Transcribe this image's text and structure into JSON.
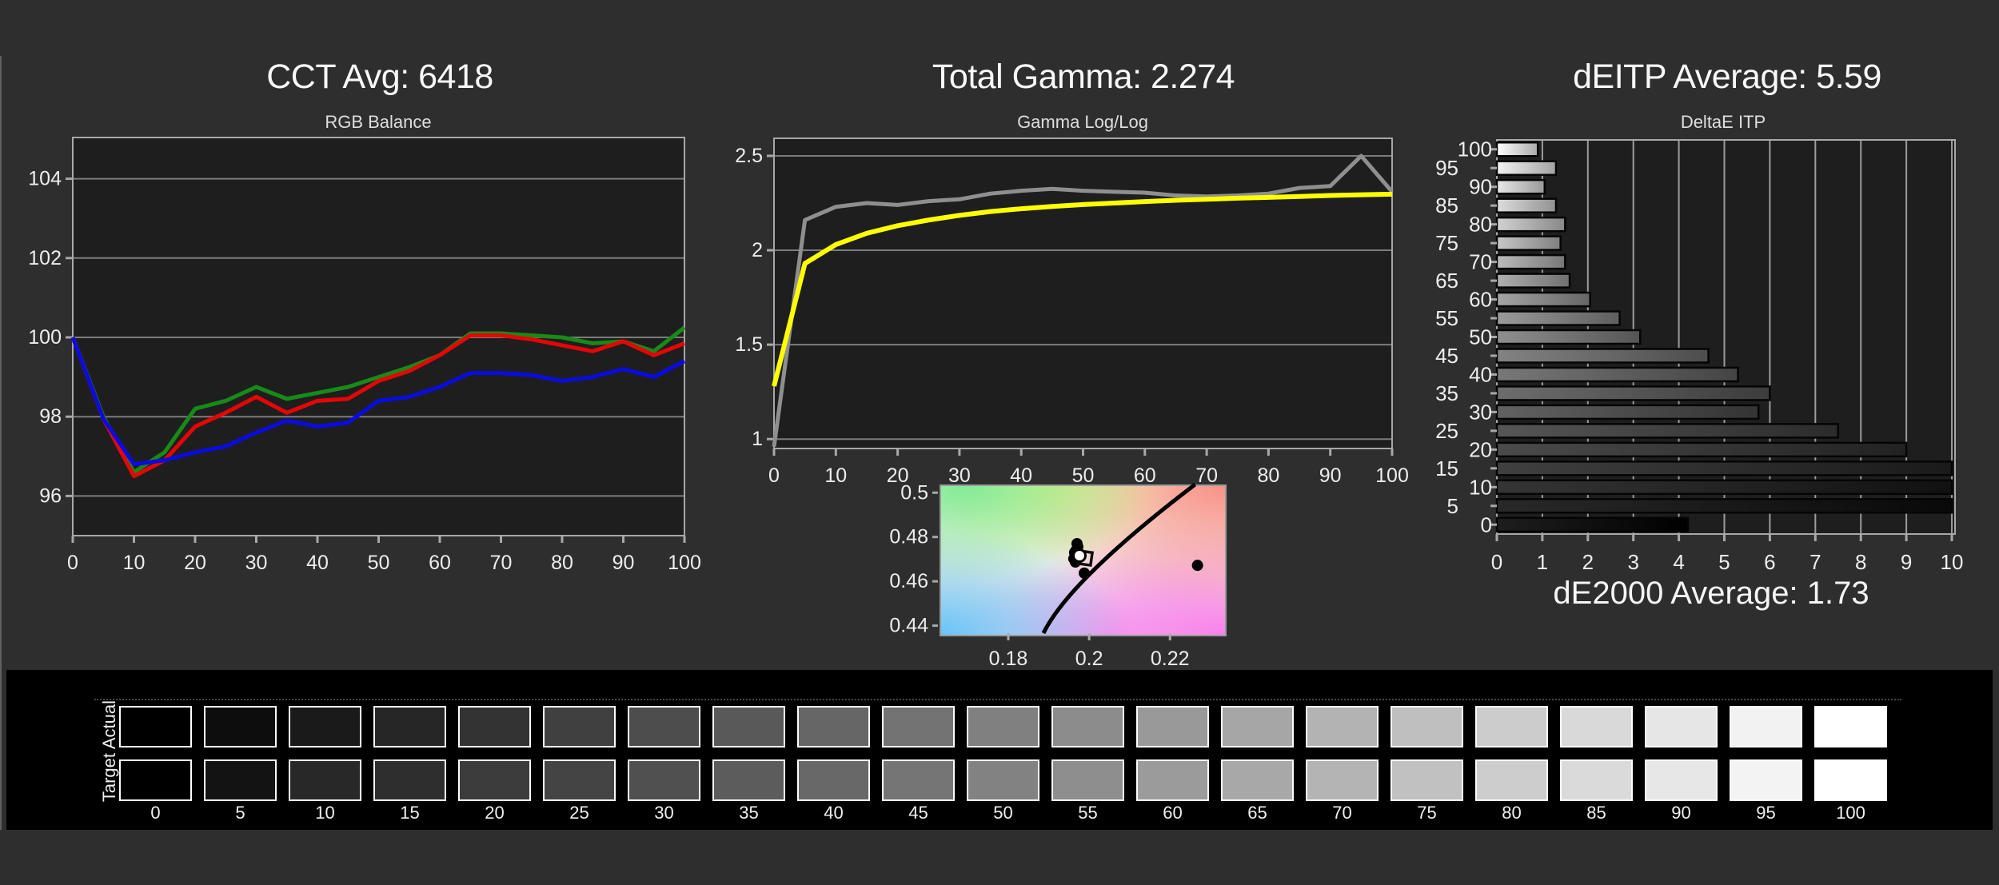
{
  "colors": {
    "background": "#2e2e2e",
    "plot_bg": "#1e1e1e",
    "frame": "#a8a8a8",
    "grid": "#7c7c7c",
    "grid_bright": "#9c9c9c",
    "text": "#ededed",
    "red_line": "#e60505",
    "green_line": "#178a17",
    "blue_line": "#0b0be0",
    "measured_line": "#8f8f8f",
    "target_line": "#ffff00",
    "locus_curve": "#000000",
    "strip_bg": "#000000",
    "swatch_border": "#fdfdfd"
  },
  "chart_data": [
    {
      "id": "rgb_balance",
      "type": "line",
      "title": "CCT Avg: 6418",
      "subtitle": "RGB Balance",
      "x": [
        0,
        5,
        10,
        15,
        20,
        25,
        30,
        35,
        40,
        45,
        50,
        55,
        60,
        65,
        70,
        75,
        80,
        85,
        90,
        95,
        100
      ],
      "series": [
        {
          "name": "Green",
          "color": "#178a17",
          "values": [
            100,
            98.0,
            96.6,
            97.1,
            98.2,
            98.4,
            98.75,
            98.45,
            98.6,
            98.75,
            99.0,
            99.25,
            99.55,
            100.1,
            100.1,
            100.05,
            100.0,
            99.85,
            99.9,
            99.65,
            100.25
          ]
        },
        {
          "name": "Red",
          "color": "#e60505",
          "values": [
            100,
            97.95,
            96.5,
            96.9,
            97.75,
            98.1,
            98.5,
            98.1,
            98.4,
            98.45,
            98.9,
            99.15,
            99.55,
            100.05,
            100.05,
            99.95,
            99.8,
            99.65,
            99.9,
            99.55,
            99.85
          ]
        },
        {
          "name": "Blue",
          "color": "#0b0be0",
          "values": [
            100,
            97.95,
            96.8,
            96.9,
            97.1,
            97.25,
            97.6,
            97.9,
            97.75,
            97.85,
            98.4,
            98.5,
            98.75,
            99.1,
            99.1,
            99.05,
            98.9,
            99.0,
            99.2,
            99.0,
            99.4
          ]
        }
      ],
      "xticks": [
        0,
        10,
        20,
        30,
        40,
        50,
        60,
        70,
        80,
        90,
        100
      ],
      "yticks": [
        96,
        98,
        100,
        102,
        104
      ],
      "xlim": [
        0,
        100
      ],
      "ylim": [
        95,
        105.04
      ],
      "grid": "horizontal"
    },
    {
      "id": "gamma_loglog",
      "type": "line",
      "title": "Total Gamma: 2.274",
      "subtitle": "Gamma Log/Log",
      "x": [
        0,
        5,
        10,
        15,
        20,
        25,
        30,
        35,
        40,
        45,
        50,
        55,
        60,
        65,
        70,
        75,
        80,
        85,
        90,
        95,
        100
      ],
      "series": [
        {
          "name": "Measured",
          "color": "#8f8f8f",
          "values": [
            0.96,
            2.16,
            2.23,
            2.25,
            2.24,
            2.26,
            2.27,
            2.3,
            2.315,
            2.325,
            2.315,
            2.31,
            2.305,
            2.29,
            2.285,
            2.29,
            2.3,
            2.33,
            2.34,
            2.5,
            2.31
          ]
        },
        {
          "name": "Target",
          "color": "#ffff00",
          "values": [
            1.28,
            1.93,
            2.03,
            2.09,
            2.13,
            2.16,
            2.185,
            2.205,
            2.22,
            2.232,
            2.242,
            2.25,
            2.258,
            2.265,
            2.27,
            2.276,
            2.28,
            2.285,
            2.29,
            2.294,
            2.297
          ]
        }
      ],
      "xticks": [
        0,
        10,
        20,
        30,
        40,
        50,
        60,
        70,
        80,
        90,
        100
      ],
      "yticks": [
        1,
        1.5,
        2,
        2.5
      ],
      "ytick_labels": [
        "1",
        "1.5",
        "2",
        "2.5"
      ],
      "xlim": [
        0,
        100
      ],
      "ylim": [
        0.95,
        2.593
      ],
      "grid": "horizontal"
    },
    {
      "id": "cie_chromaticity",
      "type": "scatter",
      "xticks": [
        0.18,
        0.2,
        0.22
      ],
      "xtick_labels": [
        "0.18",
        "0.2",
        "0.22"
      ],
      "yticks": [
        0.44,
        0.46,
        0.48,
        0.5
      ],
      "ytick_labels": [
        "0.44",
        "0.46",
        "0.48",
        "0.5"
      ],
      "xlim": [
        0.163,
        0.2332
      ],
      "ylim": [
        0.4366,
        0.5037
      ],
      "locus": {
        "p0": [
          0.1887,
          0.4366
        ],
        "p1": [
          0.1951,
          0.4605
        ],
        "p2": [
          0.2262,
          0.5037
        ]
      },
      "points_black": [
        [
          0.197,
          0.477
        ],
        [
          0.1972,
          0.4756
        ],
        [
          0.1968,
          0.4741
        ],
        [
          0.1964,
          0.473
        ],
        [
          0.1962,
          0.4702
        ],
        [
          0.1966,
          0.4687
        ],
        [
          0.1988,
          0.4637
        ],
        [
          0.2268,
          0.4672
        ]
      ],
      "point_white": [
        0.1976,
        0.4716
      ],
      "marker_square": [
        0.199,
        0.4705
      ]
    },
    {
      "id": "deltae_itp",
      "type": "bar",
      "title": "dEITP Average: 5.59",
      "subtitle": "DeltaE ITP",
      "footer": "dE2000 Average: 1.73",
      "categories": [
        0,
        5,
        10,
        15,
        20,
        25,
        30,
        35,
        40,
        45,
        50,
        55,
        60,
        65,
        70,
        75,
        80,
        85,
        90,
        95,
        100
      ],
      "values": [
        4.2,
        10,
        10,
        10,
        9.0,
        7.5,
        5.75,
        6.0,
        5.3,
        4.65,
        3.15,
        2.7,
        2.05,
        1.6,
        1.5,
        1.4,
        1.5,
        1.3,
        1.05,
        1.3,
        0.9
      ],
      "xticks": [
        0,
        1,
        2,
        3,
        4,
        5,
        6,
        7,
        8,
        9,
        10
      ],
      "xlim": [
        0,
        10.07
      ],
      "grid": "vertical"
    }
  ],
  "strip": {
    "row_labels": [
      "Actual",
      "Target"
    ],
    "levels": [
      0,
      5,
      10,
      15,
      20,
      25,
      30,
      35,
      40,
      45,
      50,
      55,
      60,
      65,
      70,
      75,
      80,
      85,
      90,
      95,
      100
    ],
    "actual_colors": [
      "#000000",
      "#0d0d0d",
      "#1a1a1a",
      "#262626",
      "#333333",
      "#404040",
      "#4d4d4d",
      "#595959",
      "#666666",
      "#737373",
      "#808080",
      "#8c8c8c",
      "#999999",
      "#a6a6a6",
      "#b3b3b3",
      "#bfbfbf",
      "#cccccc",
      "#d9d9d9",
      "#e6e6e6",
      "#f2f2f2",
      "#ffffff"
    ],
    "target_colors": [
      "#000000",
      "#131313",
      "#282828",
      "#2e2e2e",
      "#3c3c3c",
      "#444444",
      "#505050",
      "#5c5c5c",
      "#686868",
      "#757575",
      "#828282",
      "#8e8e8e",
      "#9b9b9b",
      "#a8a8a8",
      "#b4b4b4",
      "#c1c1c1",
      "#cdcdcd",
      "#dadada",
      "#e7e7e7",
      "#f3f3f3",
      "#ffffff"
    ]
  }
}
